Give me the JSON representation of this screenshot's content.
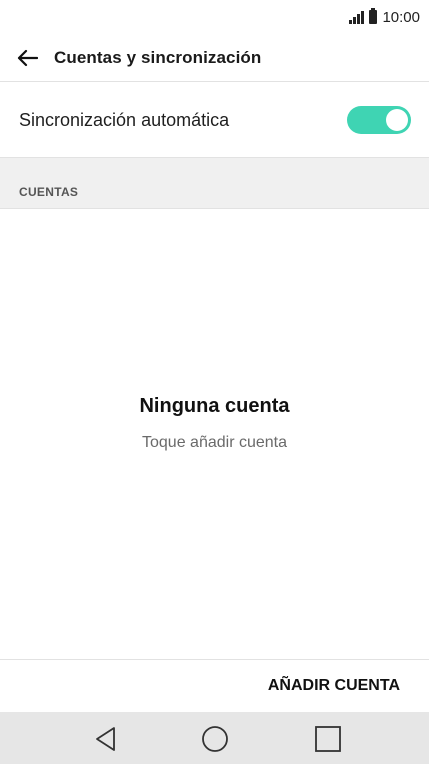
{
  "status_bar": {
    "time": "10:00",
    "icons": [
      "signal-icon",
      "battery-icon"
    ]
  },
  "app_bar": {
    "back_icon": "arrow-left-icon",
    "title": "Cuentas y sincronización"
  },
  "auto_sync": {
    "label": "Sincronización automática",
    "enabled": true,
    "toggle_color": "#3fd4b3"
  },
  "accounts_section": {
    "header": "CUENTAS"
  },
  "empty_state": {
    "title": "Ninguna cuenta",
    "subtitle": "Toque añadir cuenta"
  },
  "actions": {
    "add_account": "AÑADIR CUENTA"
  },
  "nav_bar": {
    "buttons": [
      "back-triangle-icon",
      "home-circle-icon",
      "recents-square-icon"
    ]
  }
}
